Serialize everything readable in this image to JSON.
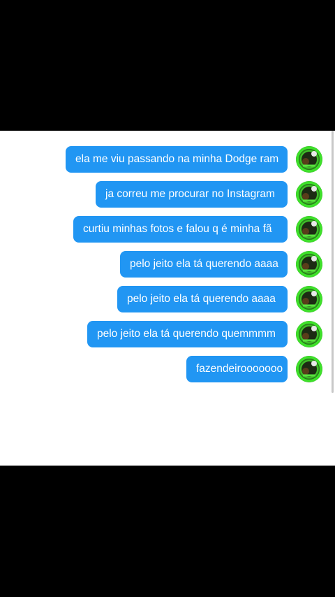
{
  "colors": {
    "bubble": "#2196f3",
    "bubble_text": "#ffffff",
    "panel_background": "#ffffff",
    "frame_background": "#000000"
  },
  "messages": [
    {
      "text": "ela me viu passando na minha Dodge ram",
      "avatar_icon": "user-avatar-icon"
    },
    {
      "text": "ja correu me procurar no Instagram",
      "avatar_icon": "user-avatar-icon"
    },
    {
      "text": "curtiu minhas fotos e falou q é minha fã",
      "avatar_icon": "user-avatar-icon"
    },
    {
      "text": "pelo jeito ela tá querendo aaaa",
      "avatar_icon": "user-avatar-icon"
    },
    {
      "text": "pelo jeito ela tá querendo aaaa",
      "avatar_icon": "user-avatar-icon"
    },
    {
      "text": "pelo jeito ela tá querendo quemmmm",
      "avatar_icon": "user-avatar-icon"
    },
    {
      "text": "fazendeirooooooo",
      "avatar_icon": "user-avatar-icon"
    }
  ]
}
